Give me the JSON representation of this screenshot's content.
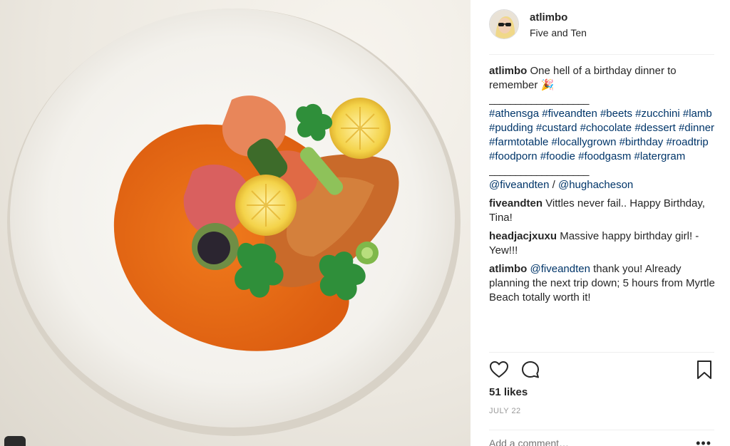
{
  "post": {
    "username": "atlimbo",
    "location": "Five and Ten",
    "caption": {
      "user": "atlimbo",
      "text": "One hell of a birthday dinner to remember",
      "emoji": "🎉",
      "rule": "___________________",
      "hashtags": "#athensga #fiveandten #beets #zucchini #lamb #pudding #custard #chocolate #dessert #dinner #farmtotable #locallygrown #birthday #roadtrip #foodporn #foodie #foodgasm #latergram",
      "rule2": "___________________",
      "mention1": "@fiveandten",
      "mention_sep": "/",
      "mention2": "@hughacheson"
    },
    "comments": [
      {
        "user": "fiveandten",
        "mention": "",
        "text": "Vittles never fail.. Happy Birthday, Tina!"
      },
      {
        "user": "headjacjxuxu",
        "mention": "",
        "text": "Massive happy birthday girl! - Yew!!!"
      },
      {
        "user": "atlimbo",
        "mention": "@fiveandten",
        "text": "thank you! Already planning the next trip down; 5 hours from Myrtle Beach totally worth it!"
      }
    ],
    "likes": "51 likes",
    "date": "JULY 22",
    "add_comment_placeholder": "Add a comment…",
    "more_label": "•••"
  },
  "icons": {
    "like": "heart-icon",
    "comment": "comment-bubble-icon",
    "save": "bookmark-icon",
    "more": "more-options-icon"
  },
  "colors": {
    "link": "#003569",
    "text": "#262626",
    "muted": "#999999",
    "divider": "#efefef"
  }
}
